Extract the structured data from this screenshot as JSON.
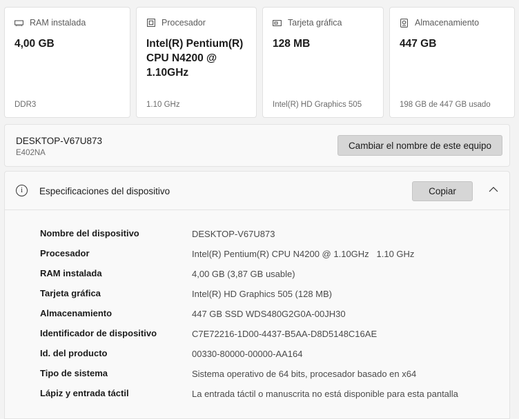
{
  "cards": [
    {
      "icon": "ram-icon",
      "label": "RAM instalada",
      "value": "4,00 GB",
      "sub": "DDR3"
    },
    {
      "icon": "processor-icon",
      "label": "Procesador",
      "value": "Intel(R) Pentium(R) CPU N4200 @ 1.10GHz",
      "sub": "1.10 GHz"
    },
    {
      "icon": "graphics-card-icon",
      "label": "Tarjeta gráfica",
      "value": "128 MB",
      "sub": "Intel(R) HD Graphics 505"
    },
    {
      "icon": "storage-icon",
      "label": "Almacenamiento",
      "value": "447 GB",
      "sub": "198 GB de 447 GB usado"
    }
  ],
  "device": {
    "name": "DESKTOP-V67U873",
    "model": "E402NA",
    "rename_button": "Cambiar el nombre de este equipo"
  },
  "specs": {
    "title": "Especificaciones del dispositivo",
    "copy_button": "Copiar",
    "rows": [
      {
        "key": "Nombre del dispositivo",
        "value": "DESKTOP-V67U873"
      },
      {
        "key": "Procesador",
        "value": "Intel(R) Pentium(R) CPU N4200 @ 1.10GHz   1.10 GHz"
      },
      {
        "key": "RAM instalada",
        "value": "4,00 GB (3,87 GB usable)"
      },
      {
        "key": "Tarjeta gráfica",
        "value": "Intel(R) HD Graphics 505 (128 MB)"
      },
      {
        "key": "Almacenamiento",
        "value": "447 GB SSD WDS480G2G0A-00JH30"
      },
      {
        "key": "Identificador de dispositivo",
        "value": "C7E72216-1D00-4437-B5AA-D8D5148C16AE"
      },
      {
        "key": "Id. del producto",
        "value": "00330-80000-00000-AA164"
      },
      {
        "key": "Tipo de sistema",
        "value": "Sistema operativo de 64 bits, procesador basado en x64"
      },
      {
        "key": "Lápiz y entrada táctil",
        "value": "La entrada táctil o manuscrita no está disponible para esta pantalla"
      }
    ]
  }
}
